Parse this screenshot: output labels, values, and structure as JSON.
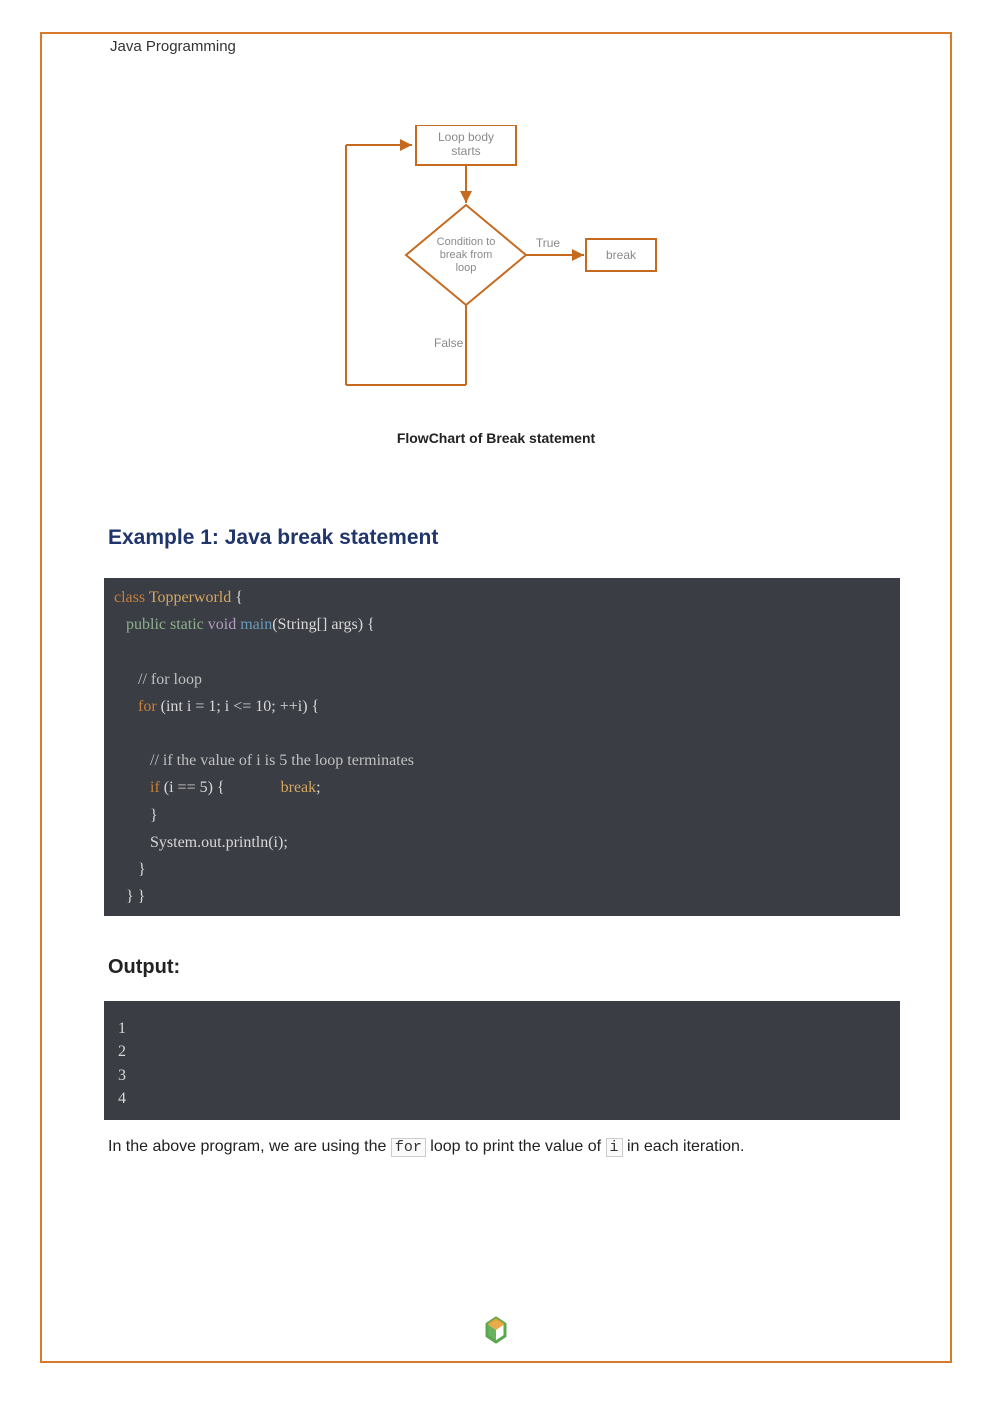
{
  "header": {
    "title": "Java Programming"
  },
  "flowchart": {
    "caption": "FlowChart of Break statement",
    "nodes": {
      "start": "Loop body\nstarts",
      "decision": "Condition to\nbreak from\nloop",
      "true_label": "True",
      "false_label": "False",
      "break_box": "break"
    }
  },
  "example": {
    "heading": "Example 1: Java break statement",
    "code": {
      "l1_class": "class",
      "l1_name": "Topperworld",
      "l1_open": " {",
      "l2_mod": "public static",
      "l2_void": " void ",
      "l2_main": "main",
      "l2_args": "(String[] args) {",
      "l3_comment": "// for loop",
      "l4_for": "for",
      "l4_rest": " (int i = 1; i <= 10; ++i) {",
      "l5_comment": "// if the value of i is 5 the loop terminates",
      "l6_if": "if",
      "l6_cond": " (i == 5) {",
      "l6_break": "break",
      "l6_semi": ";",
      "l7": "}",
      "l8": "System.out.println(i);",
      "l9": "}",
      "l10": "} }"
    }
  },
  "output": {
    "heading": "Output",
    "lines": [
      "1",
      "2",
      "3",
      "4"
    ]
  },
  "paragraph": {
    "pre": "In the above program, we are using the ",
    "code1": "for",
    "mid": " loop to print the value of ",
    "code2": "i",
    "post": " in each iteration."
  }
}
